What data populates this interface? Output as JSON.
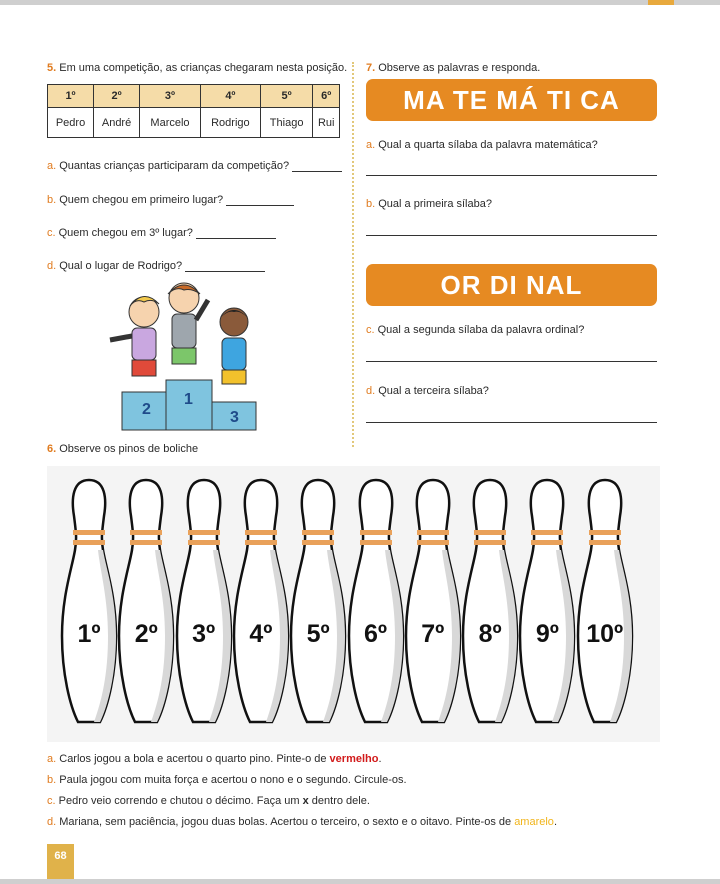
{
  "q5": {
    "number": "5.",
    "prompt": "Em uma competição, as crianças chegaram nesta posição.",
    "table": {
      "headers": [
        "1º",
        "2º",
        "3º",
        "4º",
        "5º",
        "6º"
      ],
      "names": [
        "Pedro",
        "André",
        "Marcelo",
        "Rodrigo",
        "Thiago",
        "Rui"
      ]
    },
    "items": [
      {
        "letter": "a.",
        "text": "Quantas crianças participaram da competição?"
      },
      {
        "letter": "b.",
        "text": "Quem chegou em primeiro lugar?"
      },
      {
        "letter": "c.",
        "text": "Quem chegou em 3º lugar?"
      },
      {
        "letter": "d.",
        "text": "Qual o lugar de Rodrigo?"
      }
    ],
    "podium": [
      "2",
      "1",
      "3"
    ]
  },
  "q7": {
    "number": "7.",
    "prompt": "Observe as palavras e responda.",
    "word1": "MA TE MÁ TI CA",
    "word2": "OR DI NAL",
    "items": [
      {
        "letter": "a.",
        "text": "Qual a quarta sílaba da palavra matemática?"
      },
      {
        "letter": "b.",
        "text": "Qual a primeira sílaba?"
      },
      {
        "letter": "c.",
        "text": "Qual a segunda sílaba da palavra ordinal?"
      },
      {
        "letter": "d.",
        "text": "Qual a terceira sílaba?"
      }
    ]
  },
  "q6": {
    "number": "6.",
    "prompt": "Observe os pinos de boliche",
    "pins": [
      "1º",
      "2º",
      "3º",
      "4º",
      "5º",
      "6º",
      "7º",
      "8º",
      "9º",
      "10º"
    ],
    "items": {
      "a_letter": "a.",
      "a_text": "Carlos jogou a bola e acertou o quarto pino. Pinte-o de",
      "a_color": "vermelho",
      "a_end": ".",
      "b_letter": "b.",
      "b_text": "Paula jogou com muita força e acertou o nono e o segundo. Circule-os.",
      "c_letter": "c.",
      "c_text1": "Pedro veio correndo e chutou o décimo. Faça um",
      "c_x": "x",
      "c_text2": "dentro dele.",
      "d_letter": "d.",
      "d_text": "Mariana, sem paciência, jogou duas bolas. Acertou o terceiro, o sexto e o oitavo. Pinte-os de",
      "d_color": "amarelo",
      "d_end": "."
    }
  },
  "page_number": "68",
  "colors": {
    "accent": "#e68a22",
    "table_header": "#f5dca8",
    "podium": "#7fc4df"
  }
}
